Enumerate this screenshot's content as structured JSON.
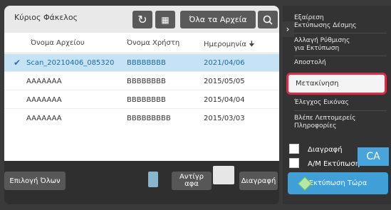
{
  "left_panel": {
    "folder_title": "Κύριος Φάκελος",
    "refresh_icon": "refresh-icon",
    "grid_icon": "grid-icon",
    "filter_label": "Όλα τα Αρχεία",
    "search_icon": "search-icon",
    "table": {
      "columns": [
        "Όνομα Αρχείου",
        "Όνομα Χρήστη",
        "Ημερομηνία"
      ],
      "sort_icon": "sort-desc-icon",
      "rows": [
        {
          "file": "Scan_20210406_085320",
          "user": "BBBBBBBB",
          "date": "2021/04/06",
          "selected": true
        },
        {
          "file": "AAAAAAA",
          "user": "BBBBBBBB",
          "date": "2015/05/05",
          "selected": false
        },
        {
          "file": "AAAAAAA",
          "user": "BBBBBBBB",
          "date": "2015/04/04",
          "selected": false
        },
        {
          "file": "AAAAAAA",
          "user": "BBBBBBBBB",
          "date": "2015/03/03",
          "selected": false
        }
      ]
    },
    "bottom": {
      "select_all": "Επιλογή Όλων",
      "copies_label_1": "Αντίγρ",
      "copies_label_2": "αφα",
      "copies_value": "",
      "delete": "Διαγραφή"
    }
  },
  "right_panel": {
    "chevron_icon": "chevron-right-icon",
    "menu": [
      {
        "line1": "Εξαίρεση",
        "line2": "Εκτύπωσης Δέσμης"
      },
      {
        "line1": "Αλλαγή Ρύθμισης",
        "line2": "για Εκτύπωση"
      },
      {
        "line1": "Αποστολή",
        "line2": ""
      },
      {
        "line1": "Μετακίνηση",
        "line2": ""
      },
      {
        "line1": "Έλεγχος Εικόνας",
        "line2": ""
      },
      {
        "line1": "Βλέπε Λεπτομερείς",
        "line2": "Πληροφορίες"
      }
    ],
    "checkboxes": [
      {
        "label": "Διαγραφή"
      },
      {
        "label": "Α/Μ Εκτύπωση"
      }
    ],
    "ca_label": "CA",
    "print_now": "Εκτύπωση Τώρα",
    "accent": "#3f9fd6",
    "highlight_color": "#d32f4a"
  }
}
